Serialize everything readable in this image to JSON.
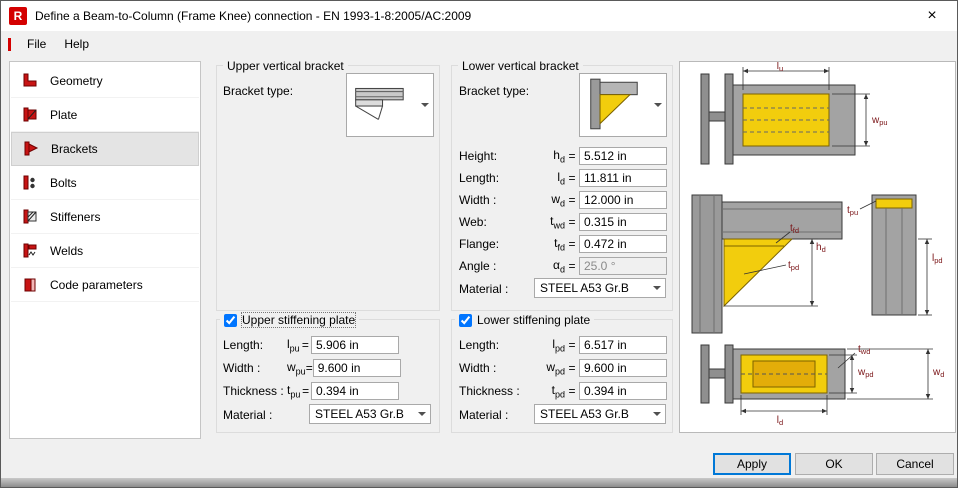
{
  "window": {
    "title": "Define a Beam-to-Column (Frame Knee) connection - EN 1993-1-8:2005/AC:2009",
    "app_badge": "R",
    "close_glyph": "×"
  },
  "menu": {
    "file": "File",
    "help": "Help"
  },
  "sidebar": {
    "items": [
      {
        "label": "Geometry"
      },
      {
        "label": "Plate"
      },
      {
        "label": "Brackets"
      },
      {
        "label": "Bolts"
      },
      {
        "label": "Stiffeners"
      },
      {
        "label": "Welds"
      },
      {
        "label": "Code parameters"
      }
    ],
    "selected": "Brackets"
  },
  "symbols": {
    "eq": "="
  },
  "upper_bracket": {
    "title": "Upper vertical bracket",
    "type_label": "Bracket type:"
  },
  "lower_bracket": {
    "title": "Lower vertical bracket",
    "type_label": "Bracket type:",
    "fields": [
      {
        "label": "Height:",
        "sym": "h",
        "sub": "d",
        "value": "5.512 in"
      },
      {
        "label": "Length:",
        "sym": "l",
        "sub": "d",
        "value": "11.811 in"
      },
      {
        "label": "Width :",
        "sym": "w",
        "sub": "d",
        "value": "12.000 in"
      },
      {
        "label": "Web:",
        "sym": "t",
        "sub": "wd",
        "value": "0.315 in"
      },
      {
        "label": "Flange:",
        "sym": "t",
        "sub": "fd",
        "value": "0.472 in"
      },
      {
        "label": "Angle :",
        "sym": "α",
        "sub": "d",
        "value": "25.0 °"
      }
    ],
    "material_label": "Material :",
    "material_value": "STEEL A53 Gr.B"
  },
  "upper_plate": {
    "title": "Upper stiffening plate",
    "checked": true,
    "fields": [
      {
        "label": "Length:",
        "sym": "l",
        "sub": "pu",
        "value": "5.906 in"
      },
      {
        "label": "Width :",
        "sym": "w",
        "sub": "pu",
        "value": "9.600 in"
      },
      {
        "label": "Thickness :",
        "sym": "t",
        "sub": "pu",
        "value": "0.394 in"
      }
    ],
    "material_label": "Material :",
    "material_value": "STEEL A53 Gr.B"
  },
  "lower_plate": {
    "title": "Lower stiffening plate",
    "checked": true,
    "fields": [
      {
        "label": "Length:",
        "sym": "l",
        "sub": "pd",
        "value": "6.517 in"
      },
      {
        "label": "Width :",
        "sym": "w",
        "sub": "pd",
        "value": "9.600 in"
      },
      {
        "label": "Thickness :",
        "sym": "t",
        "sub": "pd",
        "value": "0.394 in"
      }
    ],
    "material_label": "Material :",
    "material_value": "STEEL A53 Gr.B"
  },
  "diagram": {
    "labels": {
      "lu": {
        "sym": "l",
        "sub": "u"
      },
      "wpu": {
        "sym": "w",
        "sub": "pu"
      },
      "tpu": {
        "sym": "t",
        "sub": "pu"
      },
      "tfd": {
        "sym": "t",
        "sub": "fd"
      },
      "hd": {
        "sym": "h",
        "sub": "d"
      },
      "tpd": {
        "sym": "t",
        "sub": "pd"
      },
      "lpd": {
        "sym": "l",
        "sub": "pd"
      },
      "twd": {
        "sym": "t",
        "sub": "wd"
      },
      "wpd": {
        "sym": "w",
        "sub": "pd"
      },
      "wd": {
        "sym": "w",
        "sub": "d"
      },
      "ld": {
        "sym": "l",
        "sub": "d"
      }
    }
  },
  "buttons": {
    "apply": "Apply",
    "ok": "OK",
    "cancel": "Cancel"
  }
}
